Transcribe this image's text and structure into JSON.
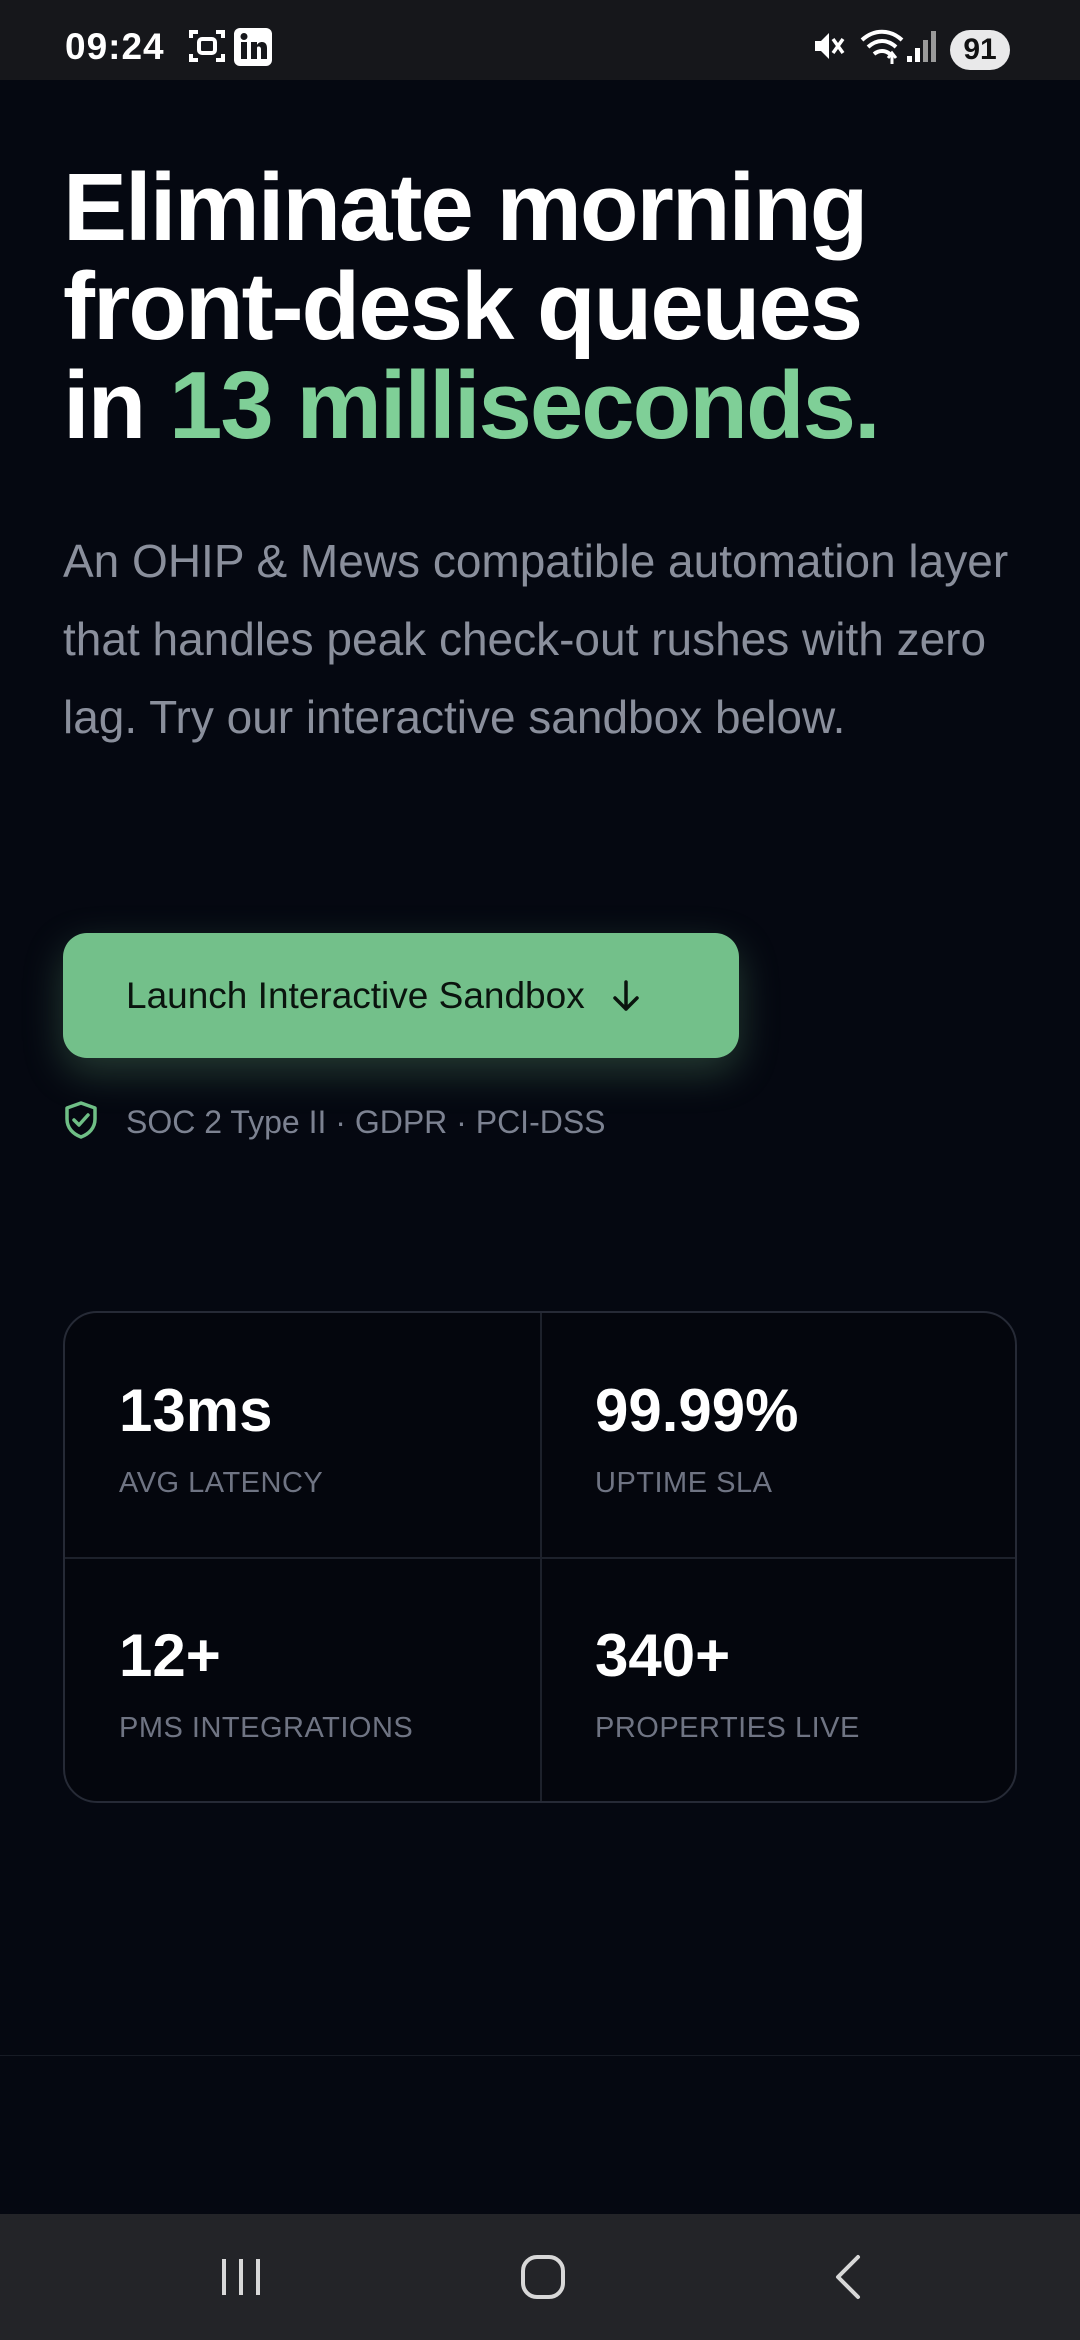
{
  "status_bar": {
    "time": "09:24",
    "battery": "91",
    "icons": [
      "screenshot-icon",
      "linkedin-icon",
      "mute-icon",
      "wifi-icon",
      "signal-icon"
    ]
  },
  "hero": {
    "headline_line1": "Eliminate morning",
    "headline_line2": "front-desk queues",
    "headline_prefix": "in ",
    "headline_accent": "13 milliseconds.",
    "subtext": "An OHIP & Mews compatible automation layer that handles peak check-out rushes with zero lag. Try our interactive sandbox below.",
    "cta_label": "Launch Interactive Sandbox",
    "compliance": "SOC 2 Type II · GDPR · PCI-DSS"
  },
  "stats": [
    {
      "value": "13ms",
      "label": "AVG LATENCY"
    },
    {
      "value": "99.99%",
      "label": "UPTIME SLA"
    },
    {
      "value": "12+",
      "label": "PMS INTEGRATIONS"
    },
    {
      "value": "340+",
      "label": "PROPERTIES LIVE"
    }
  ],
  "colors": {
    "background": "#050811",
    "accent": "#7fcf97",
    "button": "#73c08a",
    "muted_text": "#8a8f9c"
  },
  "nav_bar": {
    "buttons": [
      "recent-apps-icon",
      "home-icon",
      "back-icon"
    ]
  }
}
